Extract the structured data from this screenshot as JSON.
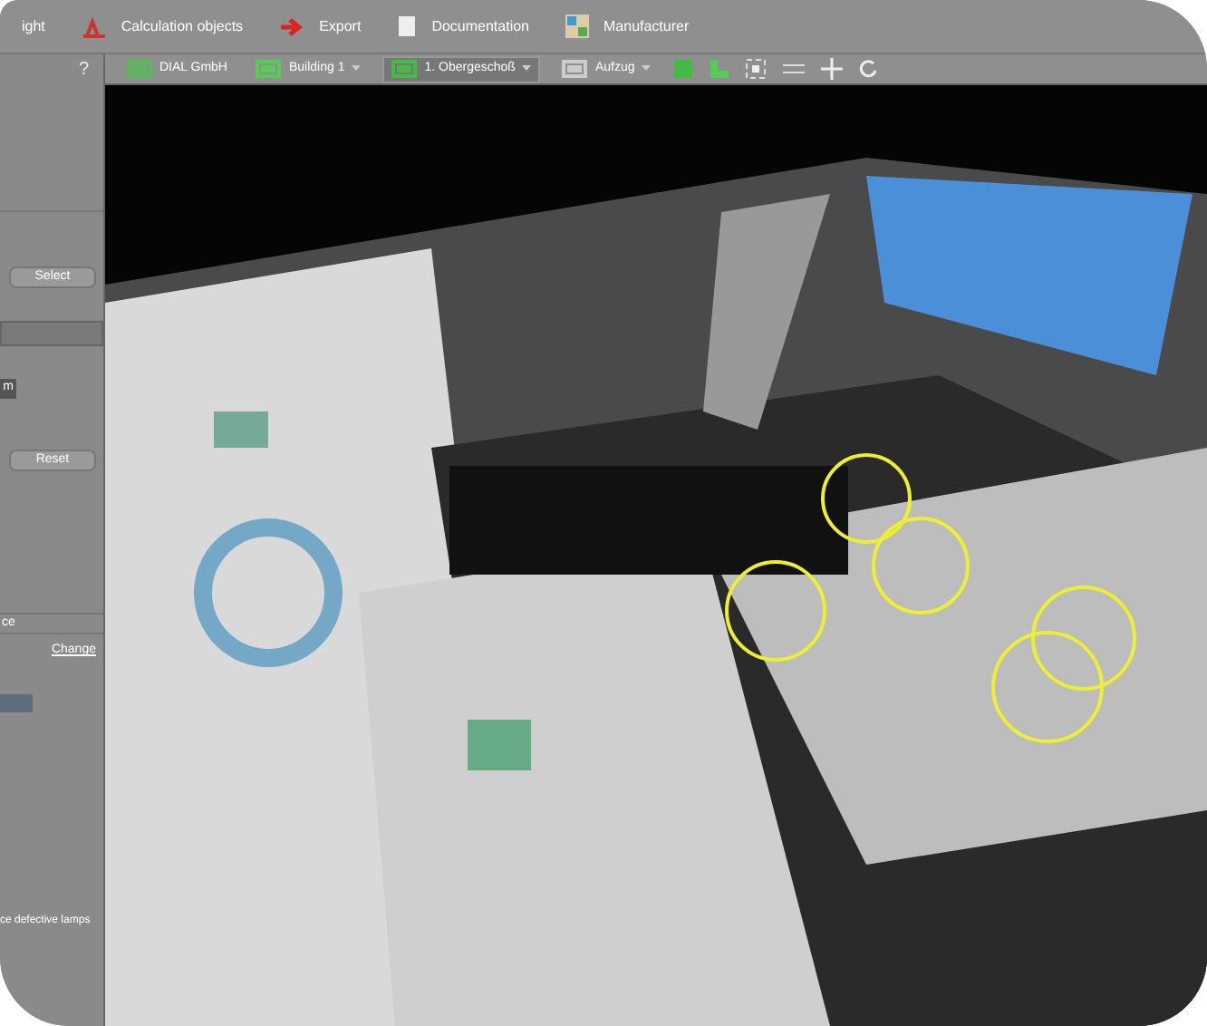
{
  "ribbon": {
    "items": [
      {
        "label": "ight"
      },
      {
        "label": "Calculation objects"
      },
      {
        "label": "Export"
      },
      {
        "label": "Documentation"
      },
      {
        "label": "Manufacturer"
      }
    ]
  },
  "toolbar": {
    "crumbs": [
      {
        "label": "DIAL GmbH",
        "selected": false
      },
      {
        "label": "Building 1",
        "selected": false
      },
      {
        "label": "1. Obergeschoß",
        "selected": true
      },
      {
        "label": "Aufzug",
        "selected": false
      }
    ]
  },
  "side_panel": {
    "help": "?",
    "select_button": "Select",
    "unit_button": "m",
    "reset_button": "Reset",
    "tab": "ce",
    "change_link": "Change",
    "note": "ce defective lamps"
  }
}
